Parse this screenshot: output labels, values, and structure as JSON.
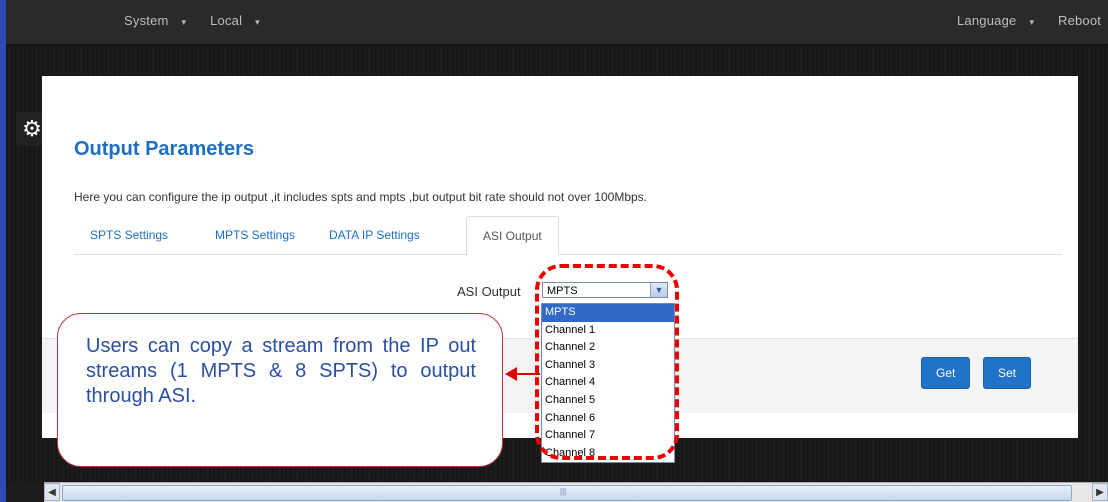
{
  "topbar": {
    "system": "System",
    "local": "Local",
    "language": "Language",
    "reboot": "Reboot"
  },
  "page": {
    "title": "Output Parameters",
    "description": "Here you can configure the ip output ,it includes spts and mpts ,but output bit rate should not over 100Mbps."
  },
  "tabs": [
    "SPTS Settings",
    "MPTS Settings",
    "DATA IP Settings",
    "ASI Output"
  ],
  "asi": {
    "label": "ASI Output",
    "selected": "MPTS",
    "options": [
      "MPTS",
      "Channel 1",
      "Channel 2",
      "Channel 3",
      "Channel 4",
      "Channel 5",
      "Channel 6",
      "Channel 7",
      "Channel 8"
    ]
  },
  "buttons": {
    "get": "Get",
    "set": "Set"
  },
  "callout": {
    "text": "Users can copy a stream from the IP out streams (1 MPTS & 8 SPTS) to output through ASI."
  },
  "icons": {
    "settings": "gear-icon",
    "dropdown": "chevron-down-icon",
    "scroll_left": "arrow-left-icon",
    "scroll_right": "arrow-right-icon"
  },
  "colors": {
    "accent": "#1d6fc4",
    "highlight": "#e00000",
    "button": "#1f73c9"
  }
}
